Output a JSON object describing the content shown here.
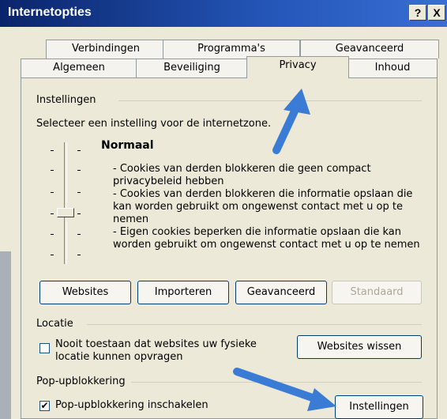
{
  "window": {
    "title": "Internetopties",
    "help_label": "?",
    "close_label": "X"
  },
  "tabs_row1": [
    "Verbindingen",
    "Programma's",
    "Geavanceerd"
  ],
  "tabs_row2": [
    "Algemeen",
    "Beveiliging",
    "Privacy",
    "Inhoud"
  ],
  "active_tab": "Privacy",
  "instellingen": {
    "group_label": "Instellingen",
    "description": "Selecteer een instelling voor de internetzone.",
    "level_title": "Normaal",
    "lines": [
      "- Cookies van derden blokkeren die geen compact",
      "privacybeleid hebben",
      "- Cookies van derden blokkeren die informatie opslaan die",
      "kan worden gebruikt om ongewenst contact met u op te",
      "nemen",
      "- Eigen cookies beperken die informatie opslaan die kan",
      "worden gebruikt om ongewenst contact met u op te nemen"
    ],
    "buttons": {
      "websites": "Websites",
      "importeren": "Importeren",
      "geavanceerd": "Geavanceerd",
      "standaard": "Standaard"
    }
  },
  "locatie": {
    "group_label": "Locatie",
    "checkbox_label_1": "Nooit toestaan dat websites uw fysieke",
    "checkbox_label_2": "locatie kunnen opvragen",
    "checked": false,
    "clear_button": "Websites wissen"
  },
  "popup": {
    "group_label": "Pop-upblokkering",
    "checkbox_label": "Pop-upblokkering inschakelen",
    "checked": true,
    "settings_button": "Instellingen"
  },
  "colors": {
    "titlebar": "#0a246a",
    "arrow": "#3a7bd5",
    "dialog": "#ece9d8"
  }
}
